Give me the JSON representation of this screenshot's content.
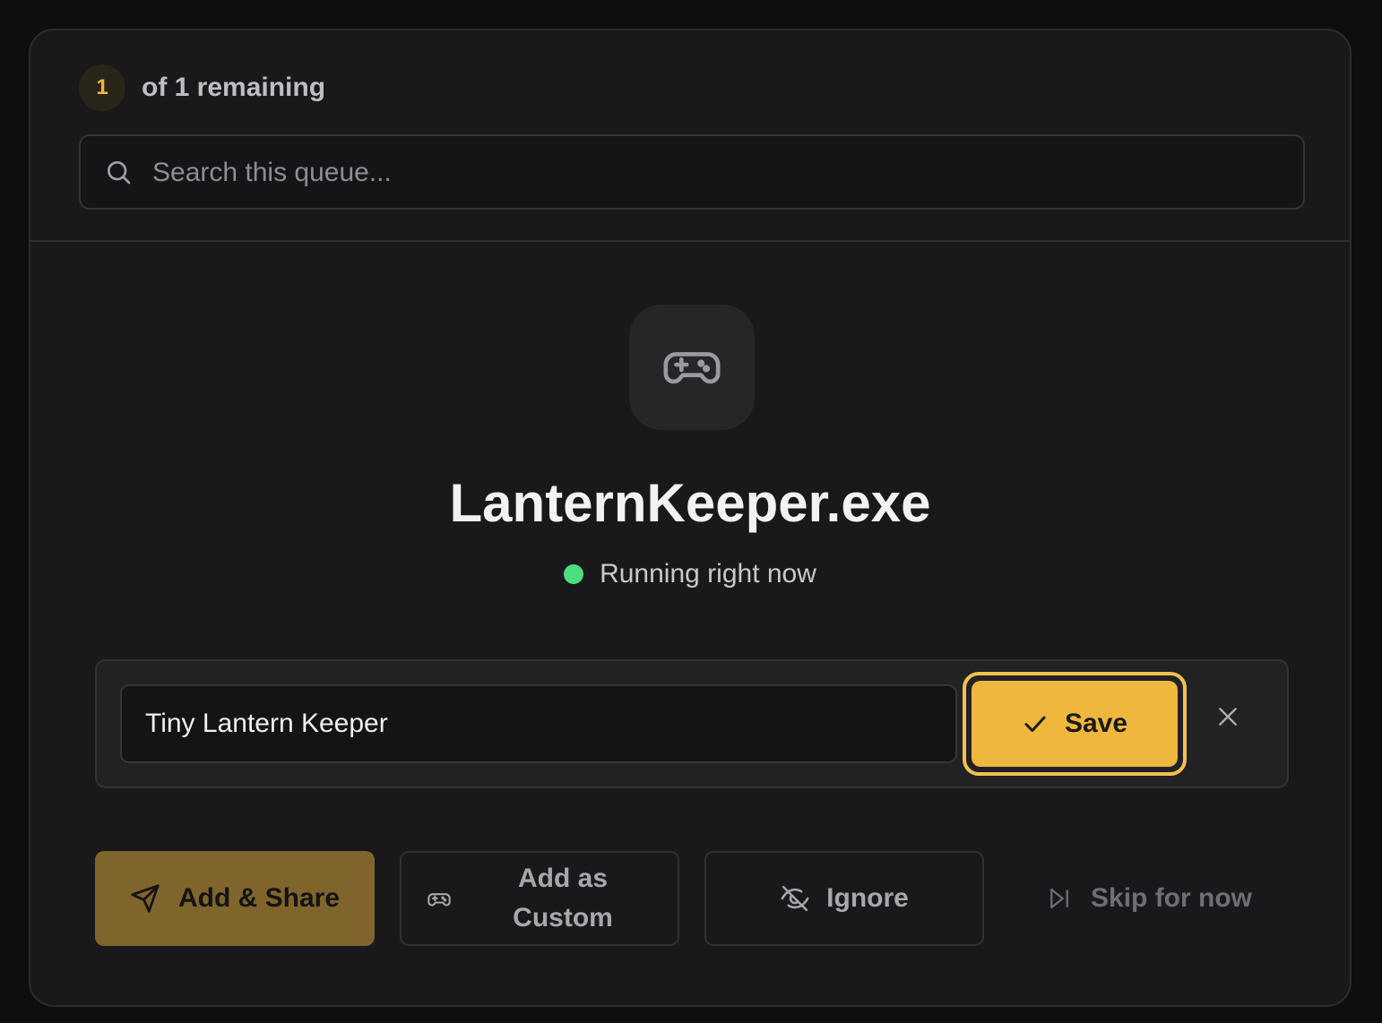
{
  "queue": {
    "position": "1",
    "remaining_label": "of 1 remaining"
  },
  "search": {
    "placeholder": "Search this queue...",
    "value": ""
  },
  "app": {
    "icon": "gamepad-icon",
    "name": "LanternKeeper.exe",
    "status_text": "Running right now",
    "status_color": "#4ade80"
  },
  "edit": {
    "value": "Tiny Lantern Keeper",
    "save_label": "Save",
    "save_icon": "check-icon",
    "close_icon": "close-icon"
  },
  "actions": {
    "add_share": {
      "label": "Add & Share",
      "icon": "send-icon"
    },
    "add_custom": {
      "label": "Add as Custom",
      "icon": "gamepad-icon"
    },
    "ignore": {
      "label": "Ignore",
      "icon": "eye-off-icon"
    },
    "skip": {
      "label": "Skip for now",
      "icon": "skip-forward-icon"
    }
  },
  "colors": {
    "accent": "#efb73e",
    "background": "#19191b",
    "page": "#0e0e0f"
  }
}
